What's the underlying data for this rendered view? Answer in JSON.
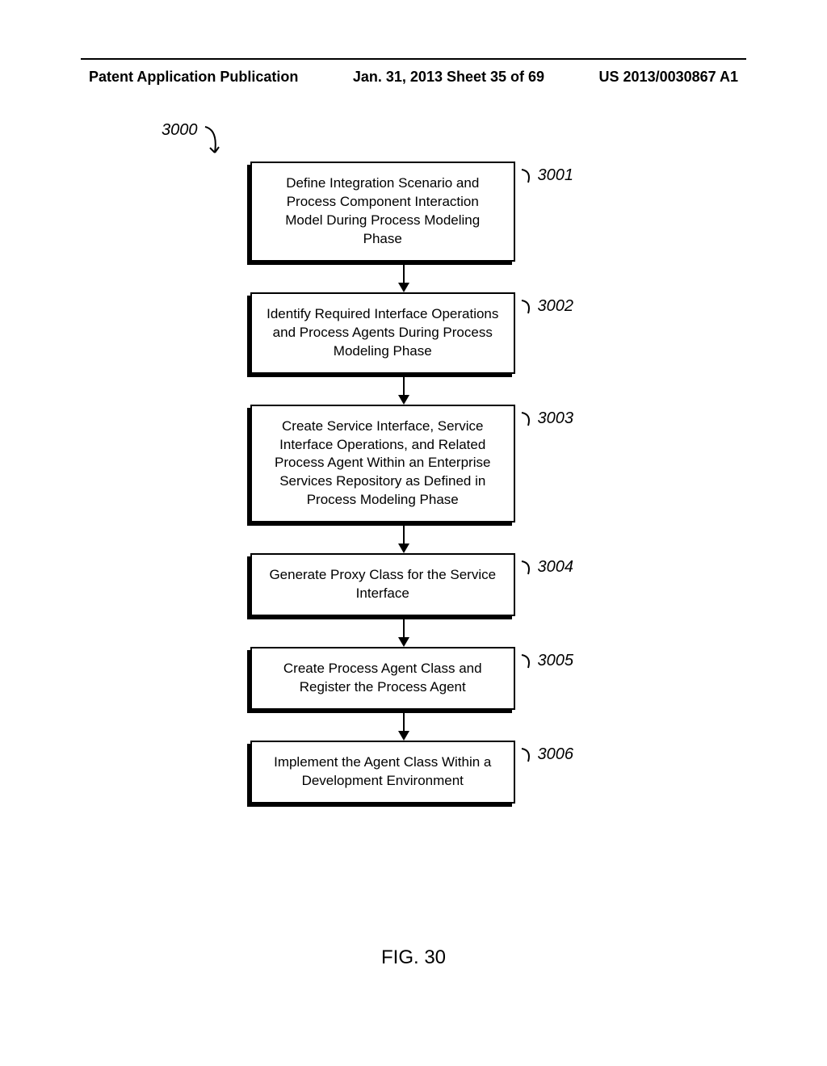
{
  "header": {
    "left": "Patent Application Publication",
    "center": "Jan. 31, 2013  Sheet 35 of 69",
    "right": "US 2013/0030867 A1"
  },
  "ref_label": "3000",
  "steps": [
    {
      "text": "Define Integration Scenario and Process Component Interaction Model During Process Modeling Phase",
      "num": "3001"
    },
    {
      "text": "Identify Required Interface Operations and Process Agents During Process Modeling Phase",
      "num": "3002"
    },
    {
      "text": "Create Service Interface, Service Interface Operations, and Related Process Agent Within an Enterprise Services Repository as Defined in Process Modeling Phase",
      "num": "3003"
    },
    {
      "text": "Generate Proxy Class for the Service Interface",
      "num": "3004"
    },
    {
      "text": "Create Process Agent Class and Register the Process Agent",
      "num": "3005"
    },
    {
      "text": "Implement the Agent Class Within a Development Environment",
      "num": "3006"
    }
  ],
  "figure_label": "FIG. 30"
}
